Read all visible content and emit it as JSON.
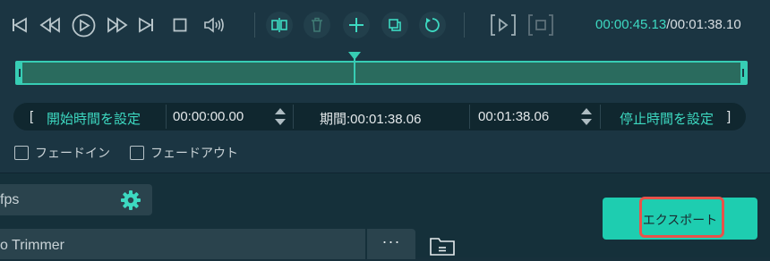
{
  "toolbar": {
    "buttons": [
      "skip-to-start",
      "step-back",
      "play",
      "step-forward",
      "skip-to-end",
      "stop",
      "volume",
      "split",
      "delete",
      "add",
      "copy",
      "reset",
      "mark-in",
      "mark-out"
    ],
    "timecode_current": "00:00:45.13",
    "timecode_total": "/00:01:38.10"
  },
  "timebar": {
    "bracket_left": "[",
    "set_start_label": "開始時間を設定",
    "start_time": "00:00:00.00",
    "duration": "期間:00:01:38.06",
    "end_time": "00:01:38.06",
    "set_end_label": "停止時間を設定",
    "bracket_right": "]"
  },
  "fades": {
    "fade_in": "フェードイン",
    "fade_out": "フェードアウト"
  },
  "output": {
    "fps_label": "fps",
    "name_label": "o Trimmer",
    "more_label": "···"
  },
  "export": {
    "label": "エクスポート"
  },
  "colors": {
    "accent": "#3dd9c1",
    "export_bg": "#1ecdb0",
    "highlight": "#e8524a"
  }
}
